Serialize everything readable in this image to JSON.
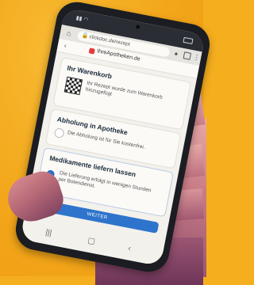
{
  "browser": {
    "url": "clickdoc.de/rezept",
    "site_title": "IhreApotheken.de"
  },
  "cart": {
    "title": "Ihr Warenkorb",
    "description": "Ihr Rezept wurde zum Warenkorb hinzugefügt"
  },
  "pickup": {
    "title": "Abholung in Apotheke",
    "description": "Die Abholung ist für Sie kostenfrei.",
    "selected": false
  },
  "delivery": {
    "title": "Medikamente liefern lassen",
    "description": "Die Lieferung erfolgt in wenigen Stunden per Botendienst.",
    "selected": true
  },
  "cta_label": "WEITER",
  "colors": {
    "background": "#f5ae1e",
    "accent": "#2e74cc"
  },
  "icons": [
    "home-icon",
    "lock-icon",
    "mic-icon",
    "tabs-icon",
    "menu-icon",
    "back-icon",
    "qr-icon"
  ]
}
